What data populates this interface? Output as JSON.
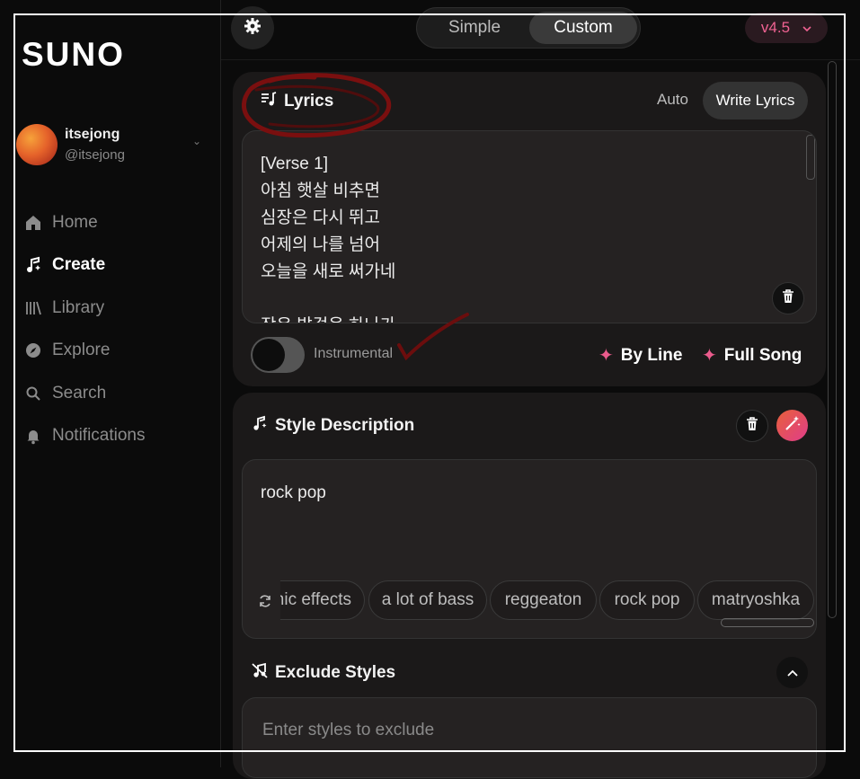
{
  "app": {
    "logo": "SUNO"
  },
  "user": {
    "name": "itsejong",
    "handle": "@itsejong"
  },
  "nav": [
    {
      "label": "Home",
      "icon": "home-icon",
      "active": false
    },
    {
      "label": "Create",
      "icon": "music-note-icon",
      "active": true
    },
    {
      "label": "Library",
      "icon": "library-icon",
      "active": false
    },
    {
      "label": "Explore",
      "icon": "compass-icon",
      "active": false
    },
    {
      "label": "Search",
      "icon": "search-icon",
      "active": false
    },
    {
      "label": "Notifications",
      "icon": "bell-icon",
      "active": false
    }
  ],
  "topbar": {
    "mode_simple": "Simple",
    "mode_custom": "Custom",
    "selected_mode": "Custom",
    "version": "v4.5"
  },
  "lyrics": {
    "title": "Lyrics",
    "auto_label": "Auto",
    "write_label": "Write Lyrics",
    "text": "[Verse 1]\n아침 햇살 비추면\n심장은 다시 뛰고\n어제의 나를 넘어\n오늘을 새로 써가네\n\n작은 발걸음 하나가",
    "instrumental_label": "Instrumental",
    "instrumental_on": false,
    "by_line_label": "By Line",
    "full_song_label": "Full Song"
  },
  "style": {
    "title": "Style Description",
    "value": "rock pop",
    "chips": [
      "mic effects",
      "a lot of bass",
      "reggeaton",
      "rock pop",
      "matryoshka"
    ]
  },
  "exclude": {
    "title": "Exclude Styles",
    "placeholder": "Enter styles to exclude"
  },
  "colors": {
    "accent": "#ea5b8c",
    "version_text": "#f06292",
    "annotation": "#7a0f0f"
  }
}
